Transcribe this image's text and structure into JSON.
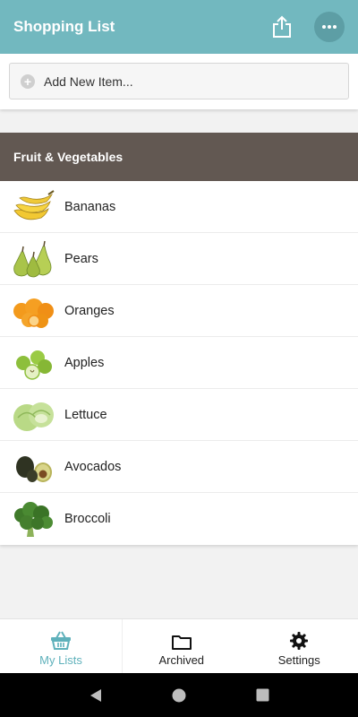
{
  "colors": {
    "appbar": "#72b8bf",
    "section_header": "#625852",
    "nav_active": "#5fb1bb"
  },
  "appbar": {
    "title": "Shopping List",
    "share_icon": "share-icon",
    "more_icon": "more-horizontal-icon"
  },
  "add_item": {
    "placeholder": "Add New Item..."
  },
  "section": {
    "title": "Fruit & Vegetables",
    "items": [
      {
        "label": "Bananas",
        "icon": "bananas-image"
      },
      {
        "label": "Pears",
        "icon": "pears-image"
      },
      {
        "label": "Oranges",
        "icon": "oranges-image"
      },
      {
        "label": "Apples",
        "icon": "apples-image"
      },
      {
        "label": "Lettuce",
        "icon": "lettuce-image"
      },
      {
        "label": "Avocados",
        "icon": "avocados-image"
      },
      {
        "label": "Broccoli",
        "icon": "broccoli-image"
      }
    ]
  },
  "bottom_nav": {
    "tabs": [
      {
        "label": "My Lists",
        "icon": "basket-icon",
        "active": true
      },
      {
        "label": "Archived",
        "icon": "folder-icon",
        "active": false
      },
      {
        "label": "Settings",
        "icon": "gear-icon",
        "active": false
      }
    ]
  },
  "system_nav": {
    "back_icon": "back-triangle-icon",
    "home_icon": "home-circle-icon",
    "recents_icon": "recents-square-icon"
  }
}
